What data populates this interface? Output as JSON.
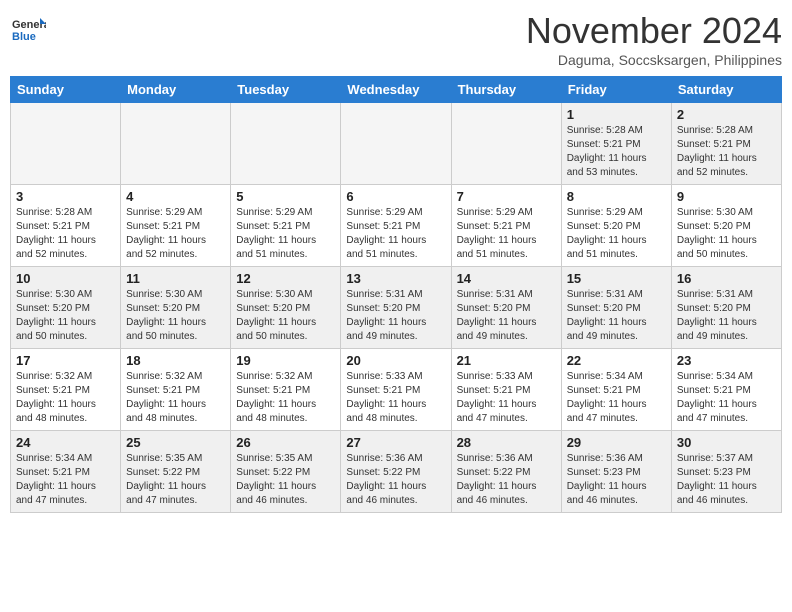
{
  "header": {
    "logo_general": "General",
    "logo_blue": "Blue",
    "month_year": "November 2024",
    "location": "Daguma, Soccsksargen, Philippines"
  },
  "weekdays": [
    "Sunday",
    "Monday",
    "Tuesday",
    "Wednesday",
    "Thursday",
    "Friday",
    "Saturday"
  ],
  "weeks": [
    [
      {
        "day": "",
        "empty": true
      },
      {
        "day": "",
        "empty": true
      },
      {
        "day": "",
        "empty": true
      },
      {
        "day": "",
        "empty": true
      },
      {
        "day": "",
        "empty": true
      },
      {
        "day": "1",
        "sunrise": "Sunrise: 5:28 AM",
        "sunset": "Sunset: 5:21 PM",
        "daylight": "Daylight: 11 hours and 53 minutes."
      },
      {
        "day": "2",
        "sunrise": "Sunrise: 5:28 AM",
        "sunset": "Sunset: 5:21 PM",
        "daylight": "Daylight: 11 hours and 52 minutes."
      }
    ],
    [
      {
        "day": "3",
        "sunrise": "Sunrise: 5:28 AM",
        "sunset": "Sunset: 5:21 PM",
        "daylight": "Daylight: 11 hours and 52 minutes."
      },
      {
        "day": "4",
        "sunrise": "Sunrise: 5:29 AM",
        "sunset": "Sunset: 5:21 PM",
        "daylight": "Daylight: 11 hours and 52 minutes."
      },
      {
        "day": "5",
        "sunrise": "Sunrise: 5:29 AM",
        "sunset": "Sunset: 5:21 PM",
        "daylight": "Daylight: 11 hours and 51 minutes."
      },
      {
        "day": "6",
        "sunrise": "Sunrise: 5:29 AM",
        "sunset": "Sunset: 5:21 PM",
        "daylight": "Daylight: 11 hours and 51 minutes."
      },
      {
        "day": "7",
        "sunrise": "Sunrise: 5:29 AM",
        "sunset": "Sunset: 5:21 PM",
        "daylight": "Daylight: 11 hours and 51 minutes."
      },
      {
        "day": "8",
        "sunrise": "Sunrise: 5:29 AM",
        "sunset": "Sunset: 5:20 PM",
        "daylight": "Daylight: 11 hours and 51 minutes."
      },
      {
        "day": "9",
        "sunrise": "Sunrise: 5:30 AM",
        "sunset": "Sunset: 5:20 PM",
        "daylight": "Daylight: 11 hours and 50 minutes."
      }
    ],
    [
      {
        "day": "10",
        "sunrise": "Sunrise: 5:30 AM",
        "sunset": "Sunset: 5:20 PM",
        "daylight": "Daylight: 11 hours and 50 minutes."
      },
      {
        "day": "11",
        "sunrise": "Sunrise: 5:30 AM",
        "sunset": "Sunset: 5:20 PM",
        "daylight": "Daylight: 11 hours and 50 minutes."
      },
      {
        "day": "12",
        "sunrise": "Sunrise: 5:30 AM",
        "sunset": "Sunset: 5:20 PM",
        "daylight": "Daylight: 11 hours and 50 minutes."
      },
      {
        "day": "13",
        "sunrise": "Sunrise: 5:31 AM",
        "sunset": "Sunset: 5:20 PM",
        "daylight": "Daylight: 11 hours and 49 minutes."
      },
      {
        "day": "14",
        "sunrise": "Sunrise: 5:31 AM",
        "sunset": "Sunset: 5:20 PM",
        "daylight": "Daylight: 11 hours and 49 minutes."
      },
      {
        "day": "15",
        "sunrise": "Sunrise: 5:31 AM",
        "sunset": "Sunset: 5:20 PM",
        "daylight": "Daylight: 11 hours and 49 minutes."
      },
      {
        "day": "16",
        "sunrise": "Sunrise: 5:31 AM",
        "sunset": "Sunset: 5:20 PM",
        "daylight": "Daylight: 11 hours and 49 minutes."
      }
    ],
    [
      {
        "day": "17",
        "sunrise": "Sunrise: 5:32 AM",
        "sunset": "Sunset: 5:21 PM",
        "daylight": "Daylight: 11 hours and 48 minutes."
      },
      {
        "day": "18",
        "sunrise": "Sunrise: 5:32 AM",
        "sunset": "Sunset: 5:21 PM",
        "daylight": "Daylight: 11 hours and 48 minutes."
      },
      {
        "day": "19",
        "sunrise": "Sunrise: 5:32 AM",
        "sunset": "Sunset: 5:21 PM",
        "daylight": "Daylight: 11 hours and 48 minutes."
      },
      {
        "day": "20",
        "sunrise": "Sunrise: 5:33 AM",
        "sunset": "Sunset: 5:21 PM",
        "daylight": "Daylight: 11 hours and 48 minutes."
      },
      {
        "day": "21",
        "sunrise": "Sunrise: 5:33 AM",
        "sunset": "Sunset: 5:21 PM",
        "daylight": "Daylight: 11 hours and 47 minutes."
      },
      {
        "day": "22",
        "sunrise": "Sunrise: 5:34 AM",
        "sunset": "Sunset: 5:21 PM",
        "daylight": "Daylight: 11 hours and 47 minutes."
      },
      {
        "day": "23",
        "sunrise": "Sunrise: 5:34 AM",
        "sunset": "Sunset: 5:21 PM",
        "daylight": "Daylight: 11 hours and 47 minutes."
      }
    ],
    [
      {
        "day": "24",
        "sunrise": "Sunrise: 5:34 AM",
        "sunset": "Sunset: 5:21 PM",
        "daylight": "Daylight: 11 hours and 47 minutes."
      },
      {
        "day": "25",
        "sunrise": "Sunrise: 5:35 AM",
        "sunset": "Sunset: 5:22 PM",
        "daylight": "Daylight: 11 hours and 47 minutes."
      },
      {
        "day": "26",
        "sunrise": "Sunrise: 5:35 AM",
        "sunset": "Sunset: 5:22 PM",
        "daylight": "Daylight: 11 hours and 46 minutes."
      },
      {
        "day": "27",
        "sunrise": "Sunrise: 5:36 AM",
        "sunset": "Sunset: 5:22 PM",
        "daylight": "Daylight: 11 hours and 46 minutes."
      },
      {
        "day": "28",
        "sunrise": "Sunrise: 5:36 AM",
        "sunset": "Sunset: 5:22 PM",
        "daylight": "Daylight: 11 hours and 46 minutes."
      },
      {
        "day": "29",
        "sunrise": "Sunrise: 5:36 AM",
        "sunset": "Sunset: 5:23 PM",
        "daylight": "Daylight: 11 hours and 46 minutes."
      },
      {
        "day": "30",
        "sunrise": "Sunrise: 5:37 AM",
        "sunset": "Sunset: 5:23 PM",
        "daylight": "Daylight: 11 hours and 46 minutes."
      }
    ]
  ]
}
